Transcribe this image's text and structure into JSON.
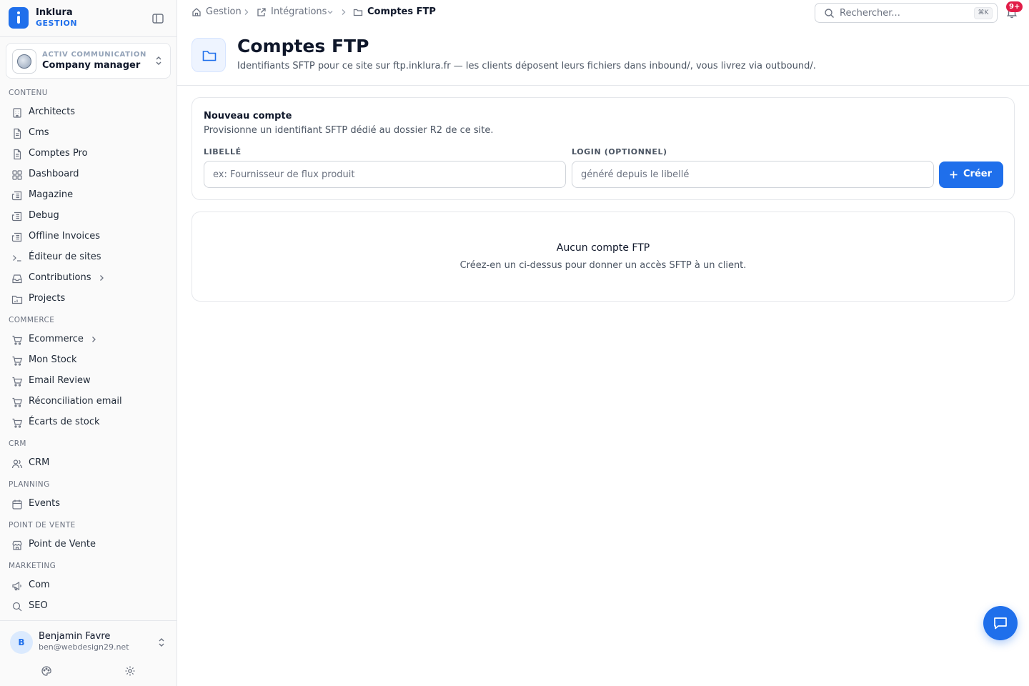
{
  "brand": {
    "name": "Inklura",
    "sub": "GESTION"
  },
  "org": {
    "label": "ACTIV COMMUNICATION",
    "name": "Company manager"
  },
  "sidebar": {
    "sections": [
      {
        "title": "CONTENU",
        "items": [
          {
            "label": "Architects",
            "icon": "building-icon"
          },
          {
            "label": "Cms",
            "icon": "file-icon"
          },
          {
            "label": "Comptes Pro",
            "icon": "file-icon"
          },
          {
            "label": "Dashboard",
            "icon": "grid-icon"
          },
          {
            "label": "Magazine",
            "icon": "newspaper-icon"
          },
          {
            "label": "Debug",
            "icon": "newspaper-icon"
          },
          {
            "label": "Offline Invoices",
            "icon": "newspaper-icon"
          },
          {
            "label": "Éditeur de sites",
            "icon": "terminal-icon"
          },
          {
            "label": "Contributions",
            "icon": "inbox-icon",
            "expandable": true
          },
          {
            "label": "Projects",
            "icon": "folder-icon"
          }
        ]
      },
      {
        "title": "COMMERCE",
        "items": [
          {
            "label": "Ecommerce",
            "icon": "cart-icon",
            "expandable": true
          },
          {
            "label": "Mon Stock",
            "icon": "cart-icon"
          },
          {
            "label": "Email Review",
            "icon": "cart-icon"
          },
          {
            "label": "Réconciliation email",
            "icon": "cart-icon"
          },
          {
            "label": "Écarts de stock",
            "icon": "cart-icon"
          }
        ]
      },
      {
        "title": "CRM",
        "items": [
          {
            "label": "CRM",
            "icon": "users-icon"
          }
        ]
      },
      {
        "title": "PLANNING",
        "items": [
          {
            "label": "Events",
            "icon": "calendar-icon"
          }
        ]
      },
      {
        "title": "POINT DE VENTE",
        "items": [
          {
            "label": "Point de Vente",
            "icon": "store-icon"
          }
        ]
      },
      {
        "title": "MARKETING",
        "items": [
          {
            "label": "Com",
            "icon": "megaphone-icon"
          },
          {
            "label": "SEO",
            "icon": "search-icon"
          }
        ]
      }
    ]
  },
  "user": {
    "initial": "B",
    "name": "Benjamin Favre",
    "email": "ben@webdesign29.net"
  },
  "breadcrumb": {
    "home": "Gestion",
    "integrations": "Intégrations",
    "current": "Comptes FTP"
  },
  "search": {
    "placeholder": "Rechercher...",
    "shortcut": "⌘K"
  },
  "notifications": {
    "badge": "9+"
  },
  "header": {
    "title": "Comptes FTP",
    "description": "Identifiants SFTP pour ce site sur ftp.inklura.fr — les clients déposent leurs fichiers dans inbound/, vous livrez via outbound/."
  },
  "form": {
    "title": "Nouveau compte",
    "description": "Provisionne un identifiant SFTP dédié au dossier R2 de ce site.",
    "label_field": {
      "label": "LIBELLÉ",
      "placeholder": "ex: Fournisseur de flux produit",
      "value": ""
    },
    "login_field": {
      "label": "LOGIN (OPTIONNEL)",
      "placeholder": "généré depuis le libellé",
      "value": ""
    },
    "submit_label": "Créer"
  },
  "empty": {
    "title": "Aucun compte FTP",
    "description": "Créez-en un ci-dessus pour donner un accès SFTP à un client."
  },
  "colors": {
    "accent": "#1f6feb",
    "badge": "#e11d48",
    "border": "#e5e7eb"
  }
}
